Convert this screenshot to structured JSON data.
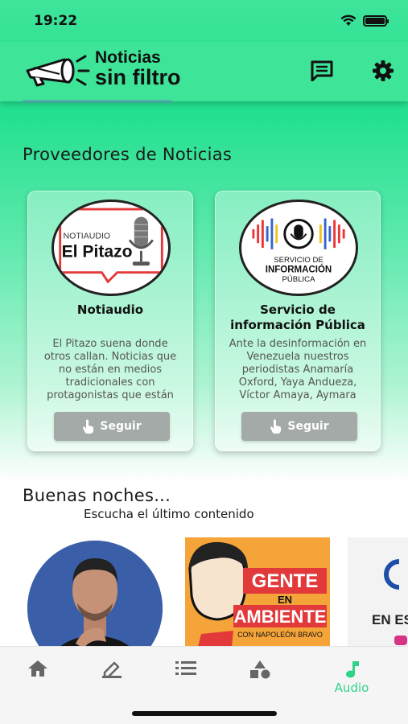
{
  "status_bar": {
    "time": "19:22"
  },
  "header": {
    "logo_line1": "Noticias",
    "logo_line2": "sin filtro"
  },
  "section_title": "Proveedores de Noticias",
  "providers": [
    {
      "logo_top": "NOTIAUDIO",
      "logo_main": "El Pitazo",
      "name": "Notiaudio",
      "description": "El Pitazo suena donde otros callan. Noticias que no están en medios tradicionales con protagonistas que están",
      "follow_label": "Seguir"
    },
    {
      "logo_top": "SERVICIO DE",
      "logo_main": "INFORMACIÓN",
      "logo_bottom": "PÚBLICA",
      "name": "Servicio de información Pública",
      "description": "Ante la desinformación en Venezuela nuestros periodistas Anamaría Oxford, Yaya Andueza, Víctor Amaya, Aymara",
      "follow_label": "Seguir"
    }
  ],
  "greeting": {
    "title": "Buenas noches...",
    "subtitle": "Escucha el último contenido"
  },
  "content_items": [
    {
      "type": "portrait"
    },
    {
      "title_line1": "GENTE",
      "title_line2": "EN",
      "title_line3": "AMBIENTE",
      "byline": "CON NAPOLEÓN BRAVO"
    },
    {
      "title": "EN ES"
    }
  ],
  "tabs": [
    {
      "icon": "home-icon",
      "label": ""
    },
    {
      "icon": "edit-icon",
      "label": ""
    },
    {
      "icon": "list-icon",
      "label": ""
    },
    {
      "icon": "shapes-icon",
      "label": ""
    },
    {
      "icon": "music-note-icon",
      "label": "Audio",
      "active": true
    }
  ],
  "colors": {
    "brand_green": "#3ee598",
    "active_tab": "#2ed38a",
    "follow_button": "#a3aaa7"
  }
}
